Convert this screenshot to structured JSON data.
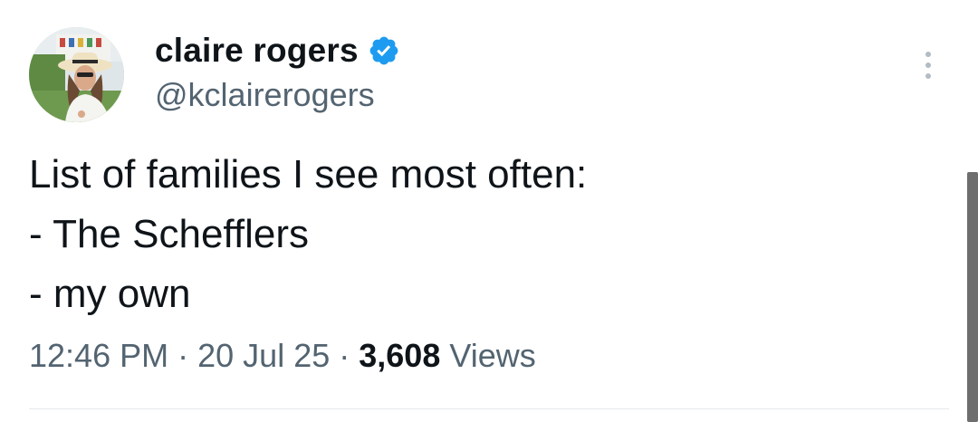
{
  "author": {
    "display_name": "claire rogers",
    "handle": "@kclairerogers",
    "verified": true,
    "verified_color": "#1d9bf0",
    "avatar_icon": "profile-photo-woman-in-hat"
  },
  "tweet": {
    "lines": [
      "List of families I see most often:",
      "- The Schefflers",
      "- my own"
    ]
  },
  "meta": {
    "time": "12:46 PM",
    "separator": "·",
    "date": "20 Jul 25",
    "views_count": "3,608",
    "views_label": "Views"
  },
  "icons": {
    "more": "more-vertical-icon",
    "verified": "verified-badge-icon"
  }
}
